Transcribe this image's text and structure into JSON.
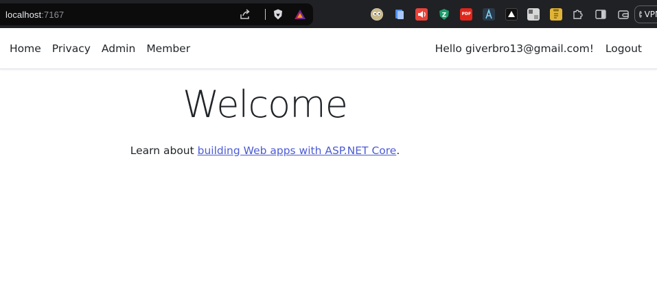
{
  "browser": {
    "url_host": "localhost",
    "url_port": ":7167",
    "extensions": [
      "eyes-icon",
      "docs-icon",
      "speaker-icon",
      "shield-z-icon",
      "pdf-icon",
      "vector-a-icon",
      "dark-triangle-icon",
      "puzzle-tile-icon",
      "clipboard-icon",
      "puzzle-icon",
      "sidebar-icon",
      "wallet-icon"
    ],
    "pdf_label": "PDF",
    "vpn_label": "VPN"
  },
  "navbar": {
    "links": [
      "Home",
      "Privacy",
      "Admin",
      "Member"
    ],
    "greeting": "Hello giverbro13@gmail.com!",
    "logout_label": "Logout"
  },
  "content": {
    "heading": "Welcome",
    "learn_prefix": "Learn about ",
    "learn_link": "building Web apps with ASP.NET Core",
    "learn_suffix": "."
  },
  "colors": {
    "chrome_bg": "#202124",
    "omnibox_bg": "#0c0c0d",
    "link": "#4b5bd5",
    "text": "#212529"
  }
}
